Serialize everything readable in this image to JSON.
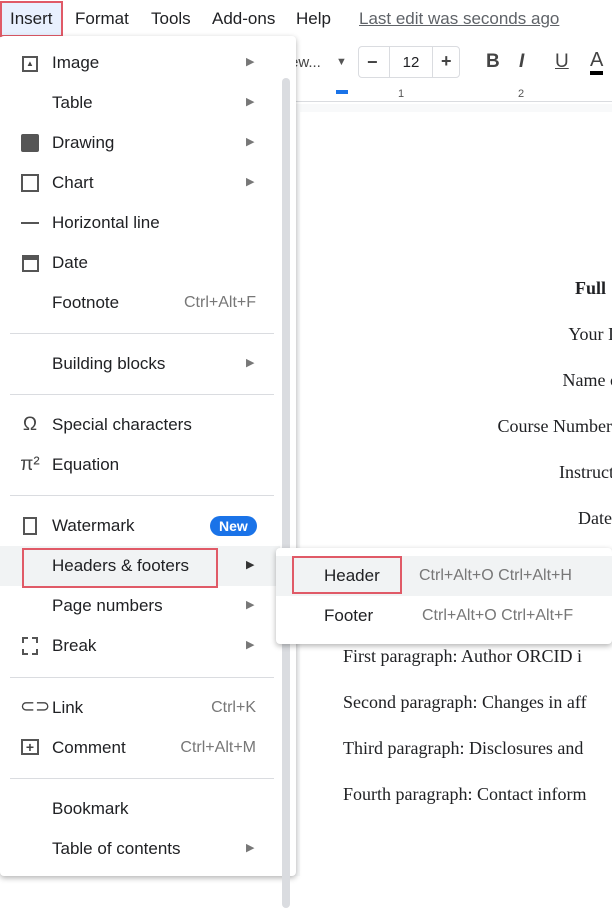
{
  "menubar": {
    "items": [
      "Insert",
      "Format",
      "Tools",
      "Add-ons",
      "Help"
    ],
    "last_edit": "Last edit was seconds ago"
  },
  "toolbar": {
    "font": "ew...",
    "font_size": "12",
    "minus": "−",
    "plus": "+",
    "bold": "B",
    "italic": "I",
    "underline": "U",
    "text_color": "A"
  },
  "ruler": {
    "marks": [
      "1",
      "2"
    ]
  },
  "document": {
    "center_lines": [
      "Full",
      "Your I",
      "Name c",
      "Course Number",
      "Instruct",
      "Date"
    ],
    "paragraphs": [
      "First paragraph: Author ORCID i",
      "Second paragraph: Changes in aff",
      "Third paragraph: Disclosures and",
      "Fourth paragraph: Contact inform"
    ]
  },
  "insert_menu": {
    "items": [
      {
        "label": "Image",
        "icon": "image-icon",
        "submenu": true
      },
      {
        "label": "Table",
        "submenu": true
      },
      {
        "label": "Drawing",
        "icon": "drawing-icon",
        "submenu": true
      },
      {
        "label": "Chart",
        "icon": "chart-icon",
        "submenu": true
      },
      {
        "label": "Horizontal line",
        "icon": "horizontal-line-icon"
      },
      {
        "label": "Date",
        "icon": "calendar-icon"
      },
      {
        "label": "Footnote",
        "shortcut": "Ctrl+Alt+F"
      },
      {
        "label": "Building blocks",
        "submenu": true
      },
      {
        "label": "Special characters",
        "icon": "omega-icon"
      },
      {
        "label": "Equation",
        "icon": "pi-icon"
      },
      {
        "label": "Watermark",
        "icon": "watermark-icon",
        "badge": "New"
      },
      {
        "label": "Headers & footers",
        "submenu": true,
        "highlighted": true
      },
      {
        "label": "Page numbers",
        "submenu": true
      },
      {
        "label": "Break",
        "icon": "break-icon",
        "submenu": true
      },
      {
        "label": "Link",
        "icon": "link-icon",
        "shortcut": "Ctrl+K"
      },
      {
        "label": "Comment",
        "icon": "comment-icon",
        "shortcut": "Ctrl+Alt+M"
      },
      {
        "label": "Bookmark"
      },
      {
        "label": "Table of contents",
        "submenu": true
      }
    ]
  },
  "headers_submenu": {
    "items": [
      {
        "label": "Header",
        "shortcut": "Ctrl+Alt+O Ctrl+Alt+H"
      },
      {
        "label": "Footer",
        "shortcut": "Ctrl+Alt+O Ctrl+Alt+F"
      }
    ]
  },
  "colors": {
    "highlight_border": "#e05a67",
    "badge": "#1a73e8",
    "active_bg": "#e8f0fe"
  }
}
